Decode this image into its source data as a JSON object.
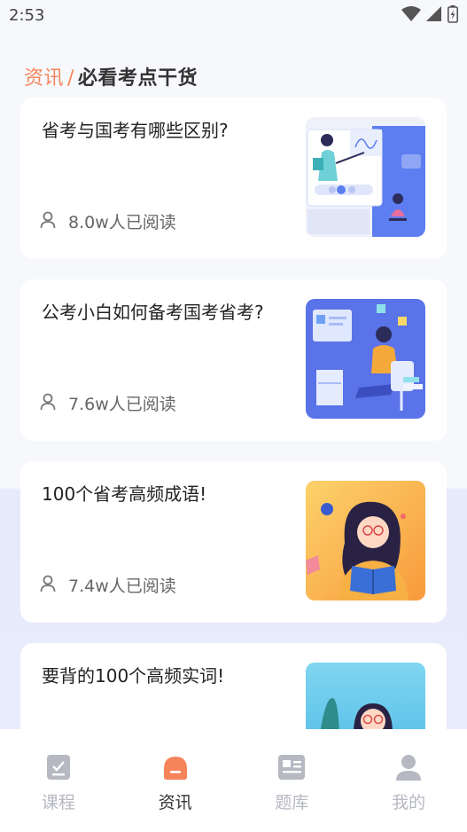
{
  "status_bar": {
    "time": "2:53"
  },
  "header": {
    "category": "资讯",
    "separator": "/",
    "subtitle": "必看考点干货"
  },
  "articles": [
    {
      "title": "省考与国考有哪些区别?",
      "reads": "8.0w人已阅读"
    },
    {
      "title": "公考小白如何备考国考省考?",
      "reads": "7.6w人已阅读"
    },
    {
      "title": "100个省考高频成语!",
      "reads": "7.4w人已阅读"
    },
    {
      "title": "要背的100个高频实词!",
      "reads": ""
    }
  ],
  "nav": {
    "items": [
      {
        "label": "课程",
        "icon": "course-icon"
      },
      {
        "label": "资讯",
        "icon": "news-icon"
      },
      {
        "label": "题库",
        "icon": "question-bank-icon"
      },
      {
        "label": "我的",
        "icon": "profile-icon"
      }
    ],
    "active_index": 1
  },
  "colors": {
    "accent": "#f5845a",
    "inactive": "#b6b8c2",
    "card_bg": "#ffffff"
  }
}
